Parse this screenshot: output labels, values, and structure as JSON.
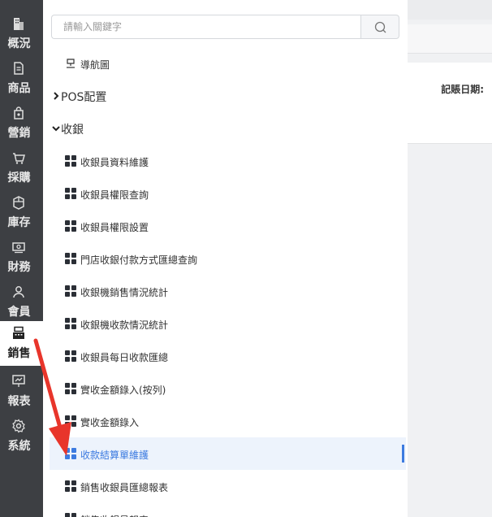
{
  "sidebar": {
    "items": [
      {
        "label": "概況",
        "icon": "building-icon"
      },
      {
        "label": "商品",
        "icon": "document-icon"
      },
      {
        "label": "營銷",
        "icon": "tag-bag-icon"
      },
      {
        "label": "採購",
        "icon": "basket-icon"
      },
      {
        "label": "庫存",
        "icon": "box-icon"
      },
      {
        "label": "財務",
        "icon": "money-icon"
      },
      {
        "label": "會員",
        "icon": "user-icon"
      },
      {
        "label": "銷售",
        "icon": "cash-register-icon"
      },
      {
        "label": "報表",
        "icon": "chart-board-icon"
      },
      {
        "label": "系統",
        "icon": "gear-icon"
      }
    ],
    "active_index": 7
  },
  "search": {
    "placeholder": "請輸入關鍵字",
    "value": ""
  },
  "menu": {
    "nav_map": "導航圖",
    "groups": [
      {
        "label": "POS配置",
        "expanded": false
      },
      {
        "label": "收銀",
        "expanded": true
      }
    ],
    "children": [
      "收銀員資料維護",
      "收銀員權限查詢",
      "收銀員權限設置",
      "門店收銀付款方式匯總查詢",
      "收銀機銷售情況統計",
      "收銀機收款情況統計",
      "收銀員每日收款匯總",
      "實收金額錄入(按列)",
      "實收金額錄入",
      "收款結算單維護",
      "銷售收銀員匯總報表",
      "銷售收銀員報表"
    ],
    "active_child": "收款結算單維護"
  },
  "background_page": {
    "label": "記賬日期:"
  },
  "colors": {
    "sidebar_bg": "#3d3f43",
    "accent": "#3d7be0",
    "arrow": "#e8352b"
  }
}
